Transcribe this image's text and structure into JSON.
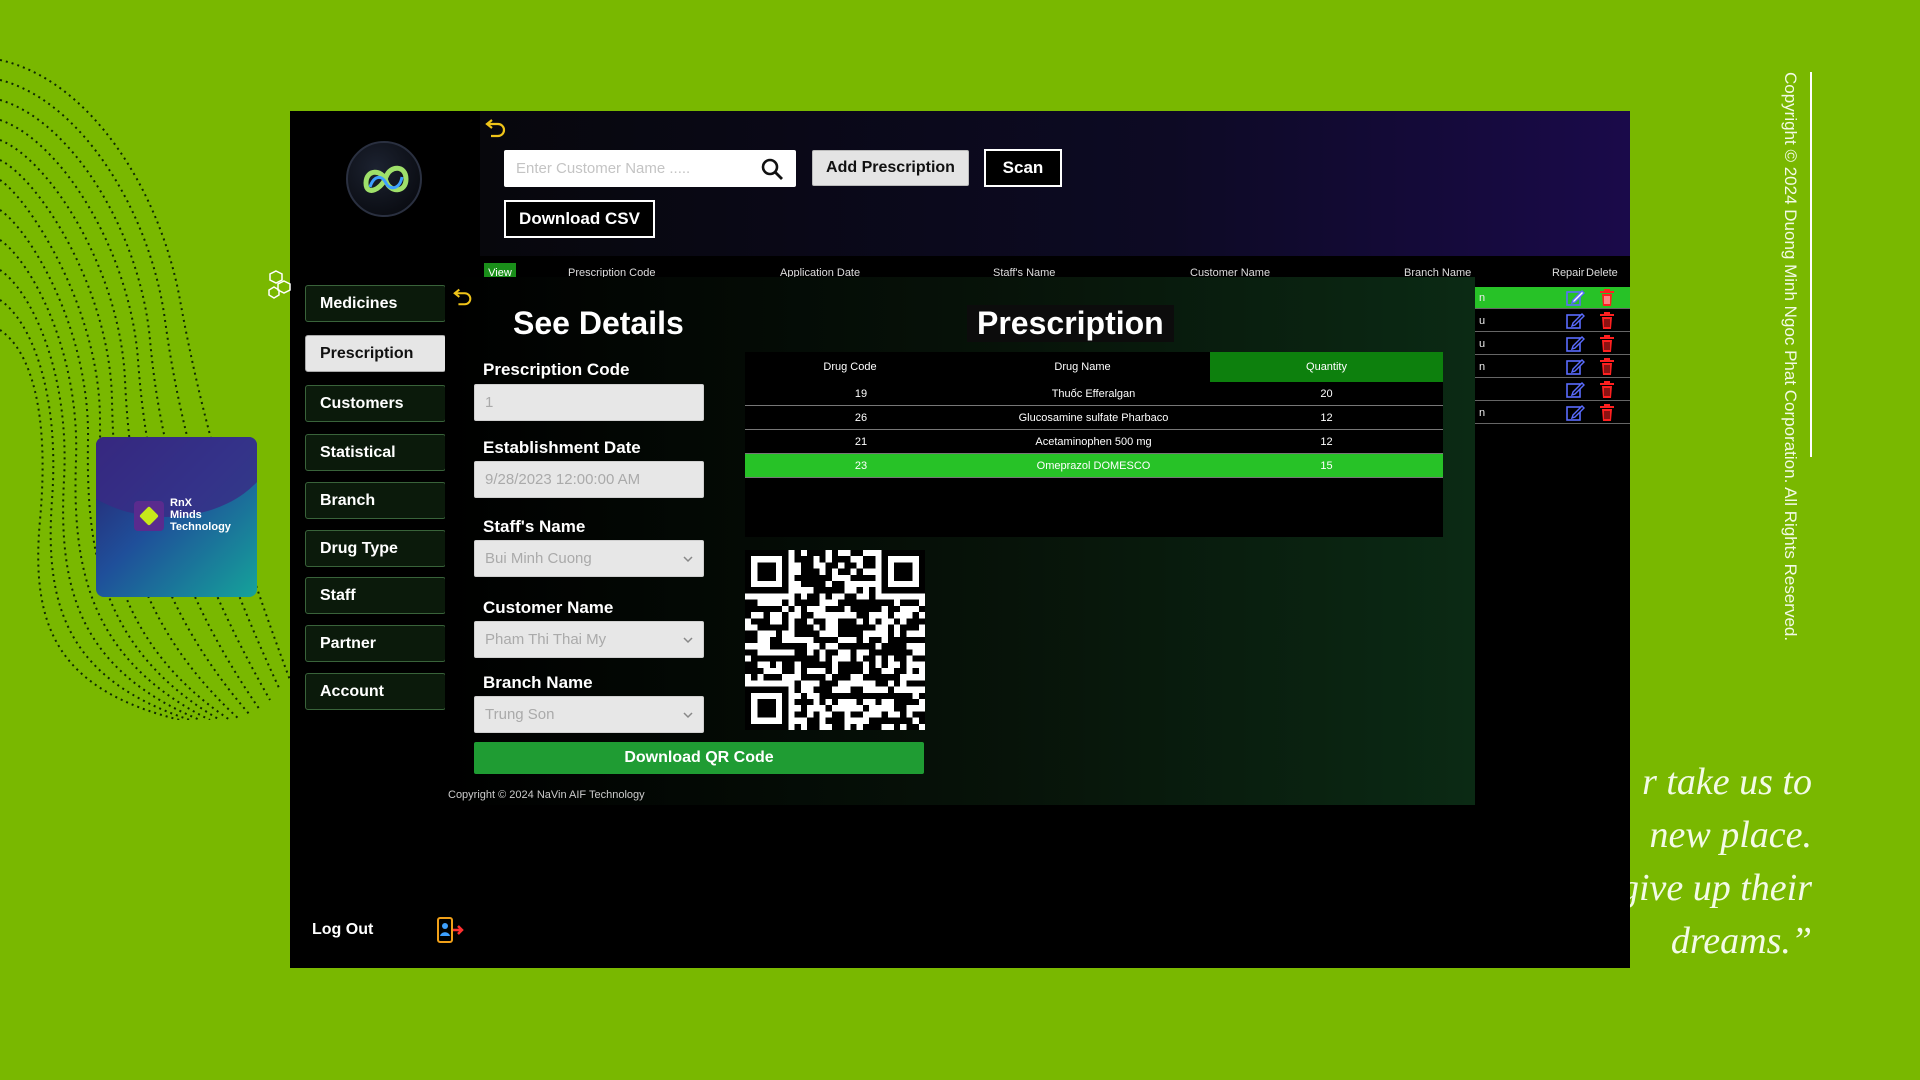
{
  "window": {
    "copyright_vertical": "Copyright © 2024 Duong Minh Ngoc Phat Corporation. All Rights Reserved."
  },
  "quote": {
    "lines": [
      "r take us to",
      "new place.",
      "give up their",
      "dreams.”"
    ]
  },
  "rnx": {
    "line1": "RnX",
    "line2": "Minds",
    "line3": "Technology"
  },
  "toolbar": {
    "search_placeholder": "Enter Customer Name .....",
    "add_label": "Add Prescription",
    "scan_label": "Scan",
    "download_csv_label": "Download CSV"
  },
  "sidebar": {
    "items": [
      {
        "label": "Medicines"
      },
      {
        "label": "Prescription",
        "active": true
      },
      {
        "label": "Customers"
      },
      {
        "label": "Statistical"
      },
      {
        "label": "Branch"
      },
      {
        "label": "Drug Type"
      },
      {
        "label": "Staff"
      },
      {
        "label": "Partner"
      },
      {
        "label": "Account"
      }
    ],
    "logout_label": "Log Out"
  },
  "main_table": {
    "headers": [
      "View",
      "Prescription Code",
      "Application Date",
      "Staff's Name",
      "Customer Name",
      "Branch Name",
      "Repair",
      "Delete"
    ],
    "rows": [
      {
        "branch": "n"
      },
      {
        "branch": "u"
      },
      {
        "branch": "u"
      },
      {
        "branch": "n"
      },
      {
        "branch": ""
      },
      {
        "branch": "n"
      }
    ]
  },
  "details": {
    "title": "See Details",
    "prescription_title": "Prescription",
    "fields": {
      "code_label": "Prescription Code",
      "code_value": "1",
      "date_label": "Establishment Date",
      "date_value": "9/28/2023 12:00:00 AM",
      "staff_label": "Staff's Name",
      "staff_value": "Bui Minh Cuong",
      "customer_label": "Customer Name",
      "customer_value": "Pham Thi Thai My",
      "branch_label": "Branch Name",
      "branch_value": "Trung Son"
    },
    "drug_table": {
      "headers": [
        "Drug Code",
        "Drug Name",
        "Quantity"
      ],
      "rows": [
        {
          "code": "19",
          "name": "Thuốc Efferalgan",
          "qty": "20"
        },
        {
          "code": "26",
          "name": "Glucosamine sulfate Pharbaco",
          "qty": "12"
        },
        {
          "code": "21",
          "name": "Acetaminophen 500 mg",
          "qty": "12"
        },
        {
          "code": "23",
          "name": "Omeprazol DOMESCO",
          "qty": "15"
        }
      ]
    },
    "download_qr_label": "Download QR Code",
    "footer_copyright": "Copyright © 2024 NaVin AIF Technology"
  },
  "colors": {
    "background": "#79b800",
    "accent_green": "#27c227",
    "button_green": "#1f9c33",
    "delete_red": "#ff2020",
    "edit_blue": "#5a6cff"
  }
}
